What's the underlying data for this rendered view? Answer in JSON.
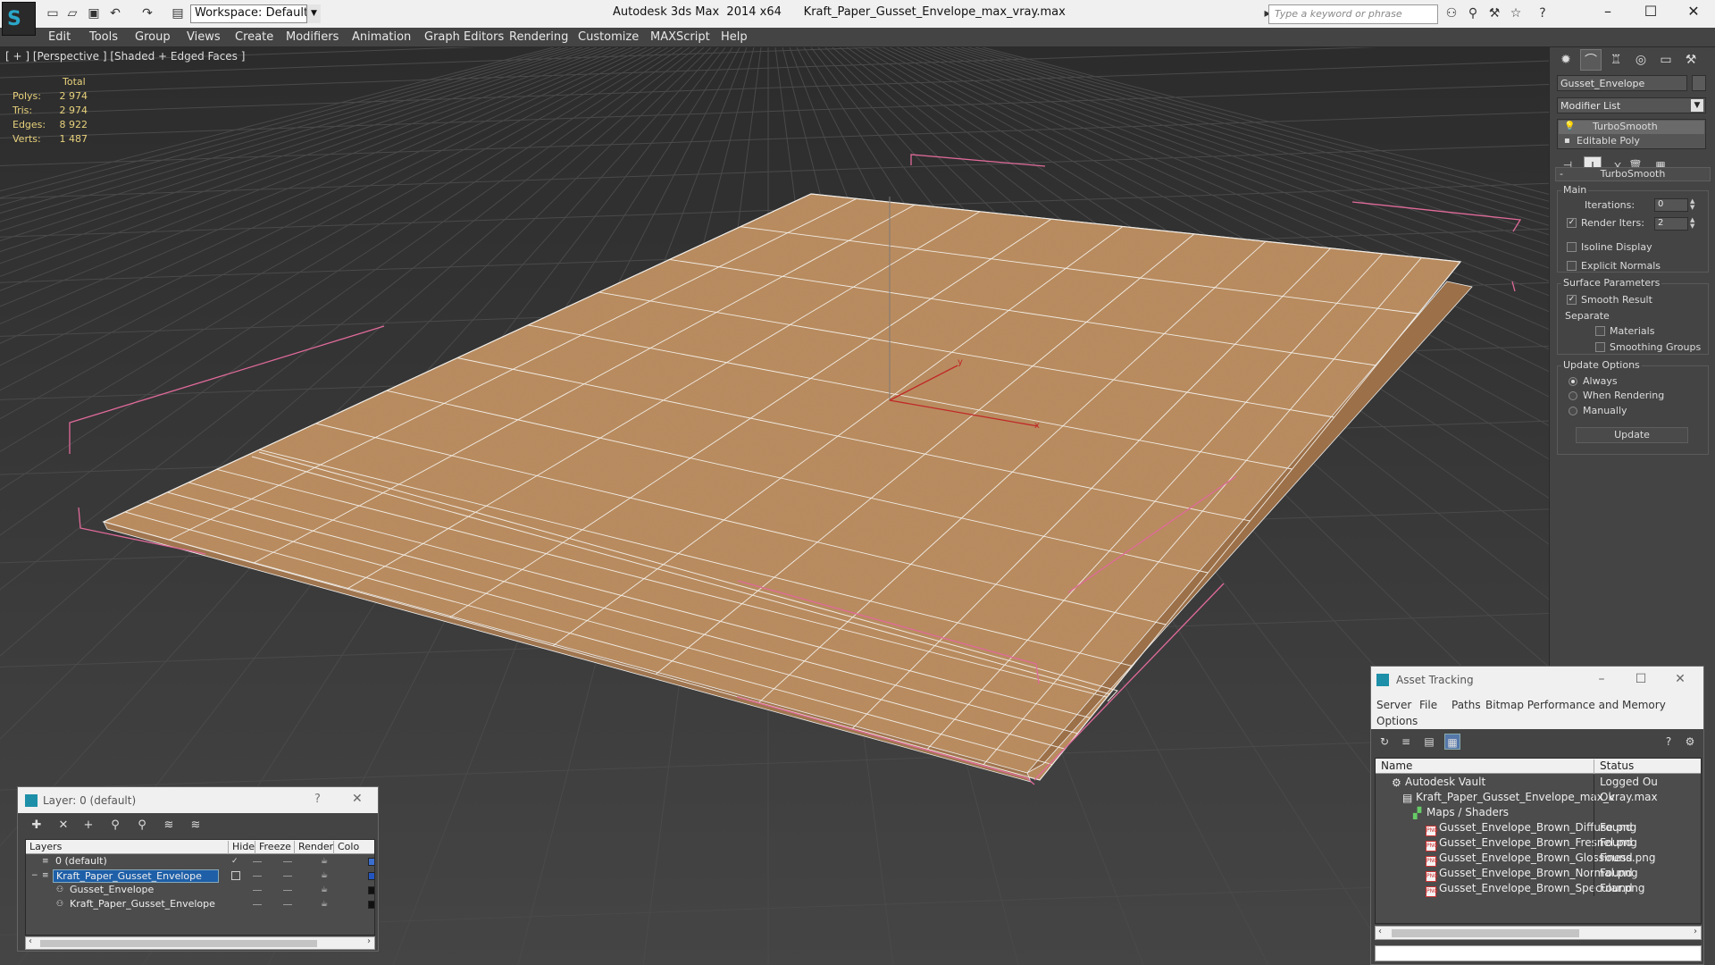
{
  "titlebar": {
    "workspace_label": "Workspace: Default",
    "title": "Autodesk 3ds Max  2014 x64      Kraft_Paper_Gusset_Envelope_max_vray.max",
    "search_placeholder": "Type a keyword or phrase"
  },
  "menu": [
    "Edit",
    "Tools",
    "Group",
    "Views",
    "Create",
    "Modifiers",
    "Animation",
    "Graph Editors",
    "Rendering",
    "Customize",
    "MAXScript",
    "Help"
  ],
  "viewport": {
    "label": "[ + ] [Perspective ] [Shaded + Edged Faces ]",
    "stats": {
      "header": "Total",
      "rows": [
        {
          "label": "Polys:",
          "value": "2 974"
        },
        {
          "label": "Tris:",
          "value": "2 974"
        },
        {
          "label": "Edges:",
          "value": "8 922"
        },
        {
          "label": "Verts:",
          "value": "1 487"
        }
      ]
    },
    "gizmo_labels": {
      "x": "x",
      "y": "y"
    }
  },
  "command_panel": {
    "object_name": "Gusset_Envelope",
    "modifier_list": "Modifier List",
    "stack": [
      "TurboSmooth",
      "Editable Poly"
    ],
    "turbosmooth": {
      "title": "TurboSmooth",
      "main_group": "Main",
      "iterations_label": "Iterations:",
      "iterations_value": "0",
      "render_iters_label": "Render Iters:",
      "render_iters_value": "2",
      "isoline_label": "Isoline Display",
      "explicit_label": "Explicit Normals",
      "surface_group": "Surface Parameters",
      "smooth_result_label": "Smooth Result",
      "separate_label": "Separate",
      "materials_label": "Materials",
      "smoothing_groups_label": "Smoothing Groups",
      "update_group": "Update Options",
      "always_label": "Always",
      "when_rendering_label": "When Rendering",
      "manually_label": "Manually",
      "update_button": "Update"
    }
  },
  "asset_tracking": {
    "title": "Asset Tracking",
    "menu": [
      "Server",
      "File",
      "Paths",
      "Bitmap Performance and Memory",
      "Options"
    ],
    "columns": {
      "name": "Name",
      "status": "Status"
    },
    "rows": [
      {
        "name": "Autodesk Vault",
        "status": "Logged Ou"
      },
      {
        "name": "Kraft_Paper_Gusset_Envelope_max_vray.max",
        "status": "Ok"
      },
      {
        "name": "Maps / Shaders",
        "status": ""
      },
      {
        "name": "Gusset_Envelope_Brown_Diffuse.png",
        "status": "Found"
      },
      {
        "name": "Gusset_Envelope_Brown_Fresnel.png",
        "status": "Found"
      },
      {
        "name": "Gusset_Envelope_Brown_Glossiness.png",
        "status": "Found"
      },
      {
        "name": "Gusset_Envelope_Brown_Normal.png",
        "status": "Found"
      },
      {
        "name": "Gusset_Envelope_Brown_Specular.png",
        "status": "Found"
      }
    ],
    "png_badge": "PNG"
  },
  "layer_window": {
    "title": "Layer: 0 (default)",
    "help": "?",
    "columns": [
      "Layers",
      "Hide",
      "Freeze",
      "Render",
      "Colo"
    ],
    "rows": [
      {
        "name": "0 (default)",
        "color": "#3a6fd0"
      },
      {
        "name": "Kraft_Paper_Gusset_Envelope",
        "color": "#2255c0"
      },
      {
        "name": "Gusset_Envelope",
        "color": "#111111"
      },
      {
        "name": "Kraft_Paper_Gusset_Envelope",
        "color": "#111111"
      }
    ]
  },
  "colors": {
    "paper": "#b98a5c",
    "selection_bracket": "#e06a9a",
    "stats_text": "#e8d27c"
  }
}
